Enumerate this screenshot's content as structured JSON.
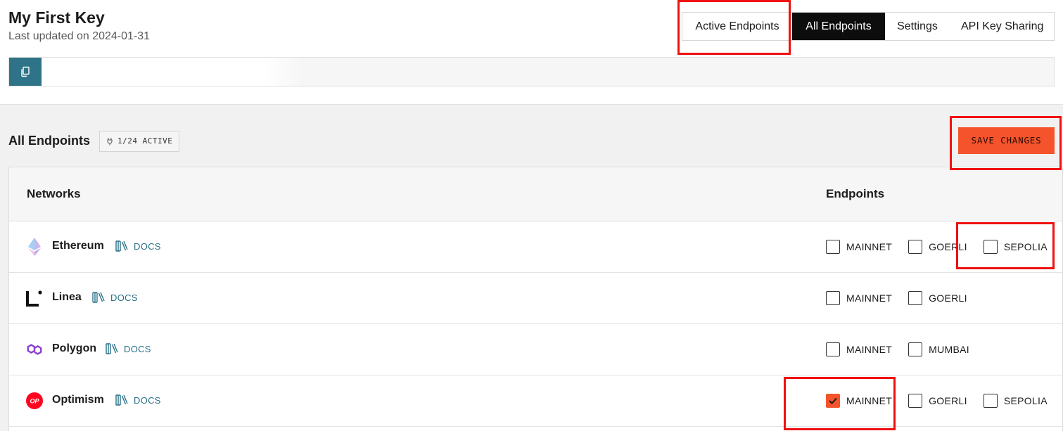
{
  "header": {
    "title": "My First Key",
    "subtitle": "Last updated on 2024-01-31",
    "tabs": [
      {
        "label": "Active Endpoints"
      },
      {
        "label": "All Endpoints"
      },
      {
        "label": "Settings"
      },
      {
        "label": "API Key Sharing"
      }
    ]
  },
  "section": {
    "title": "All Endpoints",
    "badge": "1/24 ACTIVE",
    "save_label": "SAVE CHANGES"
  },
  "table": {
    "headers": {
      "networks": "Networks",
      "endpoints": "Endpoints"
    },
    "docs_label": "DOCS",
    "rows": [
      {
        "name": "Ethereum",
        "icon": "ethereum-icon",
        "endpoints": [
          {
            "label": "MAINNET",
            "checked": false
          },
          {
            "label": "GOERLI",
            "checked": false
          },
          {
            "label": "SEPOLIA",
            "checked": false
          }
        ]
      },
      {
        "name": "Linea",
        "icon": "linea-icon",
        "endpoints": [
          {
            "label": "MAINNET",
            "checked": false
          },
          {
            "label": "GOERLI",
            "checked": false
          }
        ]
      },
      {
        "name": "Polygon",
        "icon": "polygon-icon",
        "endpoints": [
          {
            "label": "MAINNET",
            "checked": false
          },
          {
            "label": "MUMBAI",
            "checked": false
          }
        ]
      },
      {
        "name": "Optimism",
        "icon": "optimism-icon",
        "icon_text": "OP",
        "endpoints": [
          {
            "label": "MAINNET",
            "checked": true
          },
          {
            "label": "GOERLI",
            "checked": false
          },
          {
            "label": "SEPOLIA",
            "checked": false
          }
        ]
      }
    ]
  },
  "colors": {
    "accent": "#f4532c",
    "teal": "#2e7387",
    "annotation": "#f01010"
  }
}
